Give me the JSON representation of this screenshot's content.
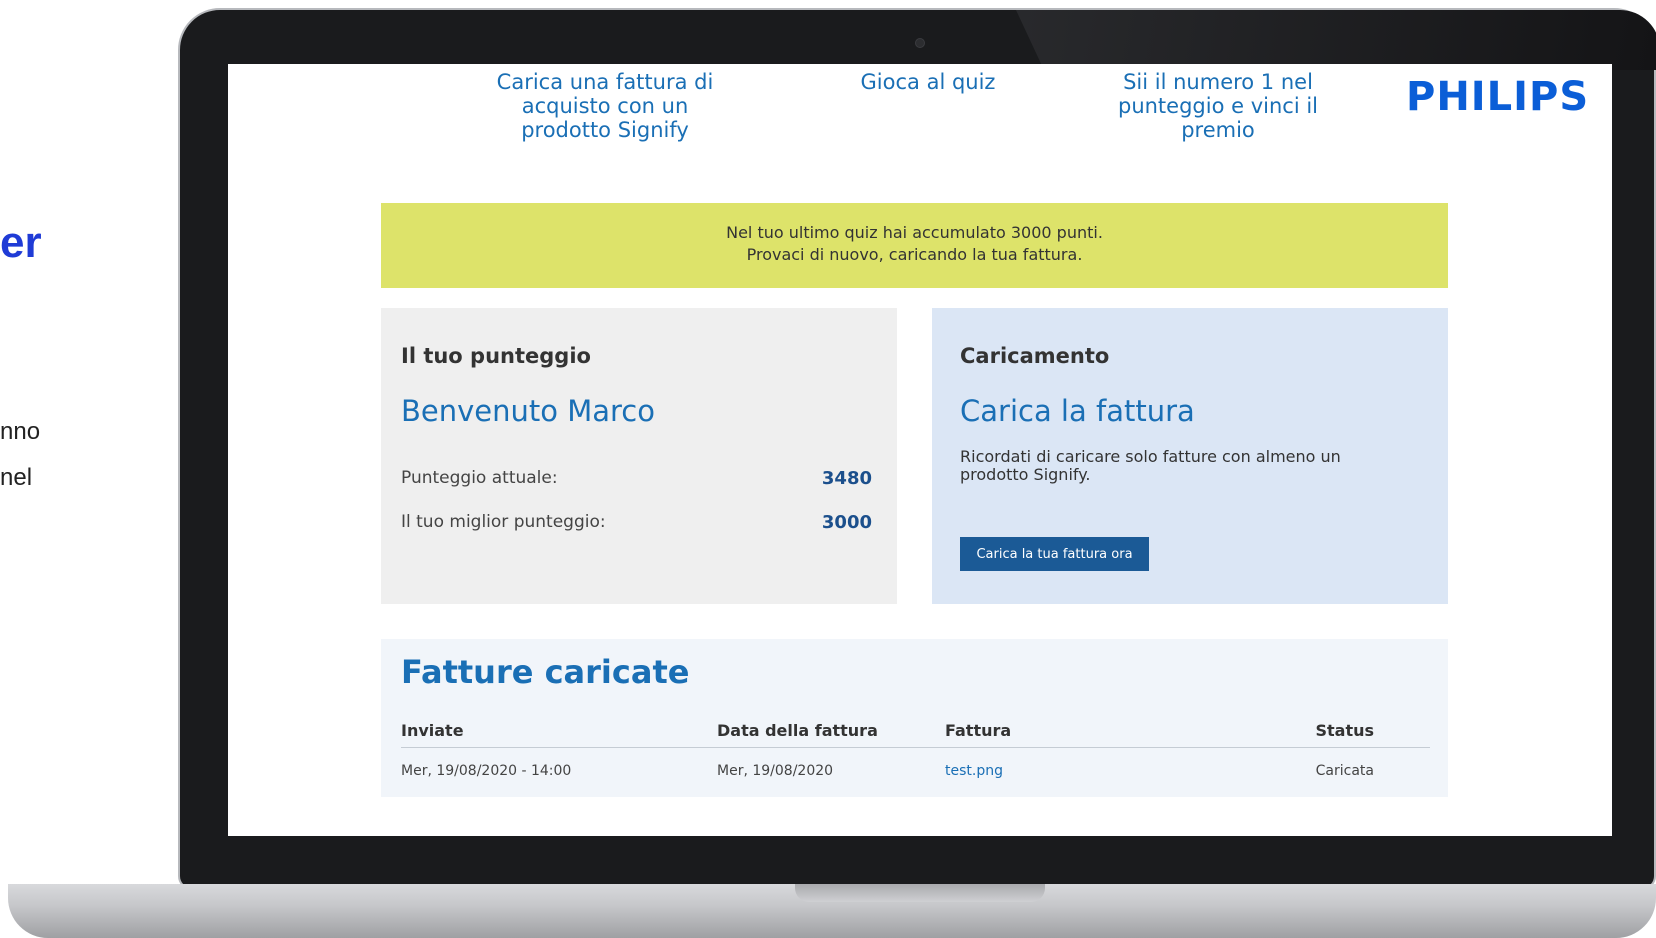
{
  "slide": {
    "title_fragment": "er",
    "line1_fragment": "nno",
    "line2_fragment": "nel"
  },
  "nav": {
    "item1": "Carica una fattura di acquisto con un prodotto Signify",
    "item2": "Gioca al quiz",
    "item3": "Sii il numero 1 nel punteggio e vinci il premio",
    "logo": "PHILIPS"
  },
  "banner": {
    "line1": "Nel tuo ultimo quiz hai accumulato 3000 punti.",
    "line2": "Provaci di nuovo, caricando la tua fattura."
  },
  "score_card": {
    "heading": "Il tuo punteggio",
    "welcome": "Benvenuto Marco",
    "current_label": "Punteggio attuale:",
    "current_value": "3480",
    "best_label": "Il tuo miglior punteggio:",
    "best_value": "3000"
  },
  "upload_card": {
    "heading": "Caricamento",
    "title": "Carica la fattura",
    "description": "Ricordati di caricare solo fatture con almeno un prodotto Signify.",
    "button": "Carica la tua fattura ora"
  },
  "invoices": {
    "title": "Fatture caricate",
    "columns": [
      "Inviate",
      "Data della fattura",
      "Fattura",
      "Status"
    ],
    "rows": [
      {
        "sent": "Mer, 19/08/2020 - 14:00",
        "date": "Mer, 19/08/2020",
        "file": "test.png",
        "status": "Caricata"
      }
    ]
  },
  "colors": {
    "accent": "#1a6fb5",
    "logo": "#0b5ed7",
    "banner": "#dde36a",
    "button": "#1b5a96"
  }
}
